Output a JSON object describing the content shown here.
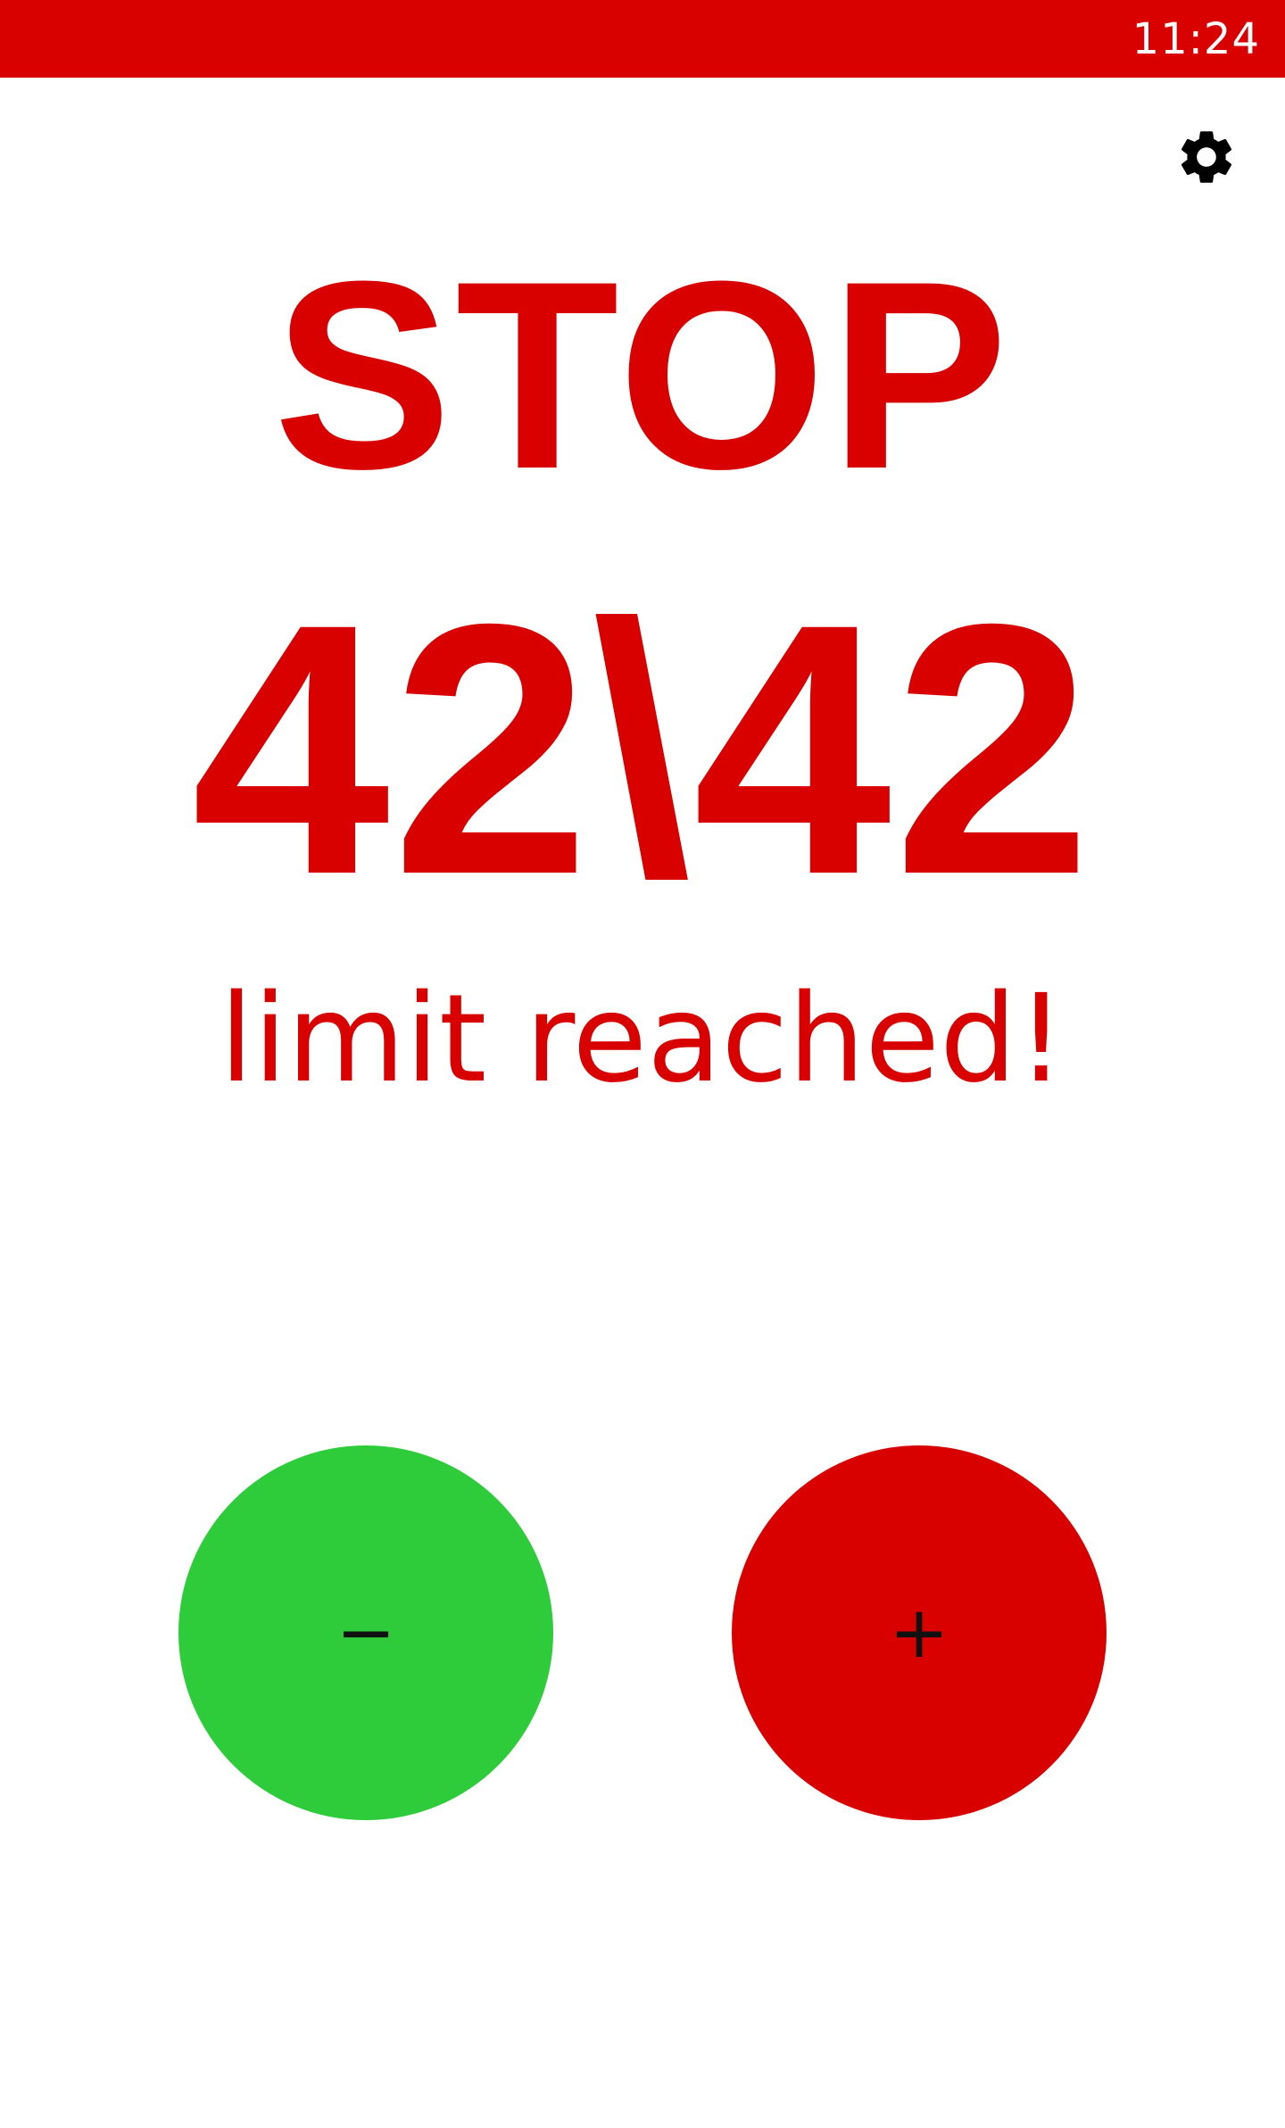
{
  "status_bar": {
    "time": "11:24",
    "color": "#d90000"
  },
  "toolbar": {
    "settings_icon": "gear-icon"
  },
  "main": {
    "title": "STOP",
    "counter": "42\\42",
    "message": "limit reached!"
  },
  "controls": {
    "minus_label": "−",
    "plus_label": "+",
    "minus_color": "#2ecc3a",
    "plus_color": "#d90000"
  }
}
